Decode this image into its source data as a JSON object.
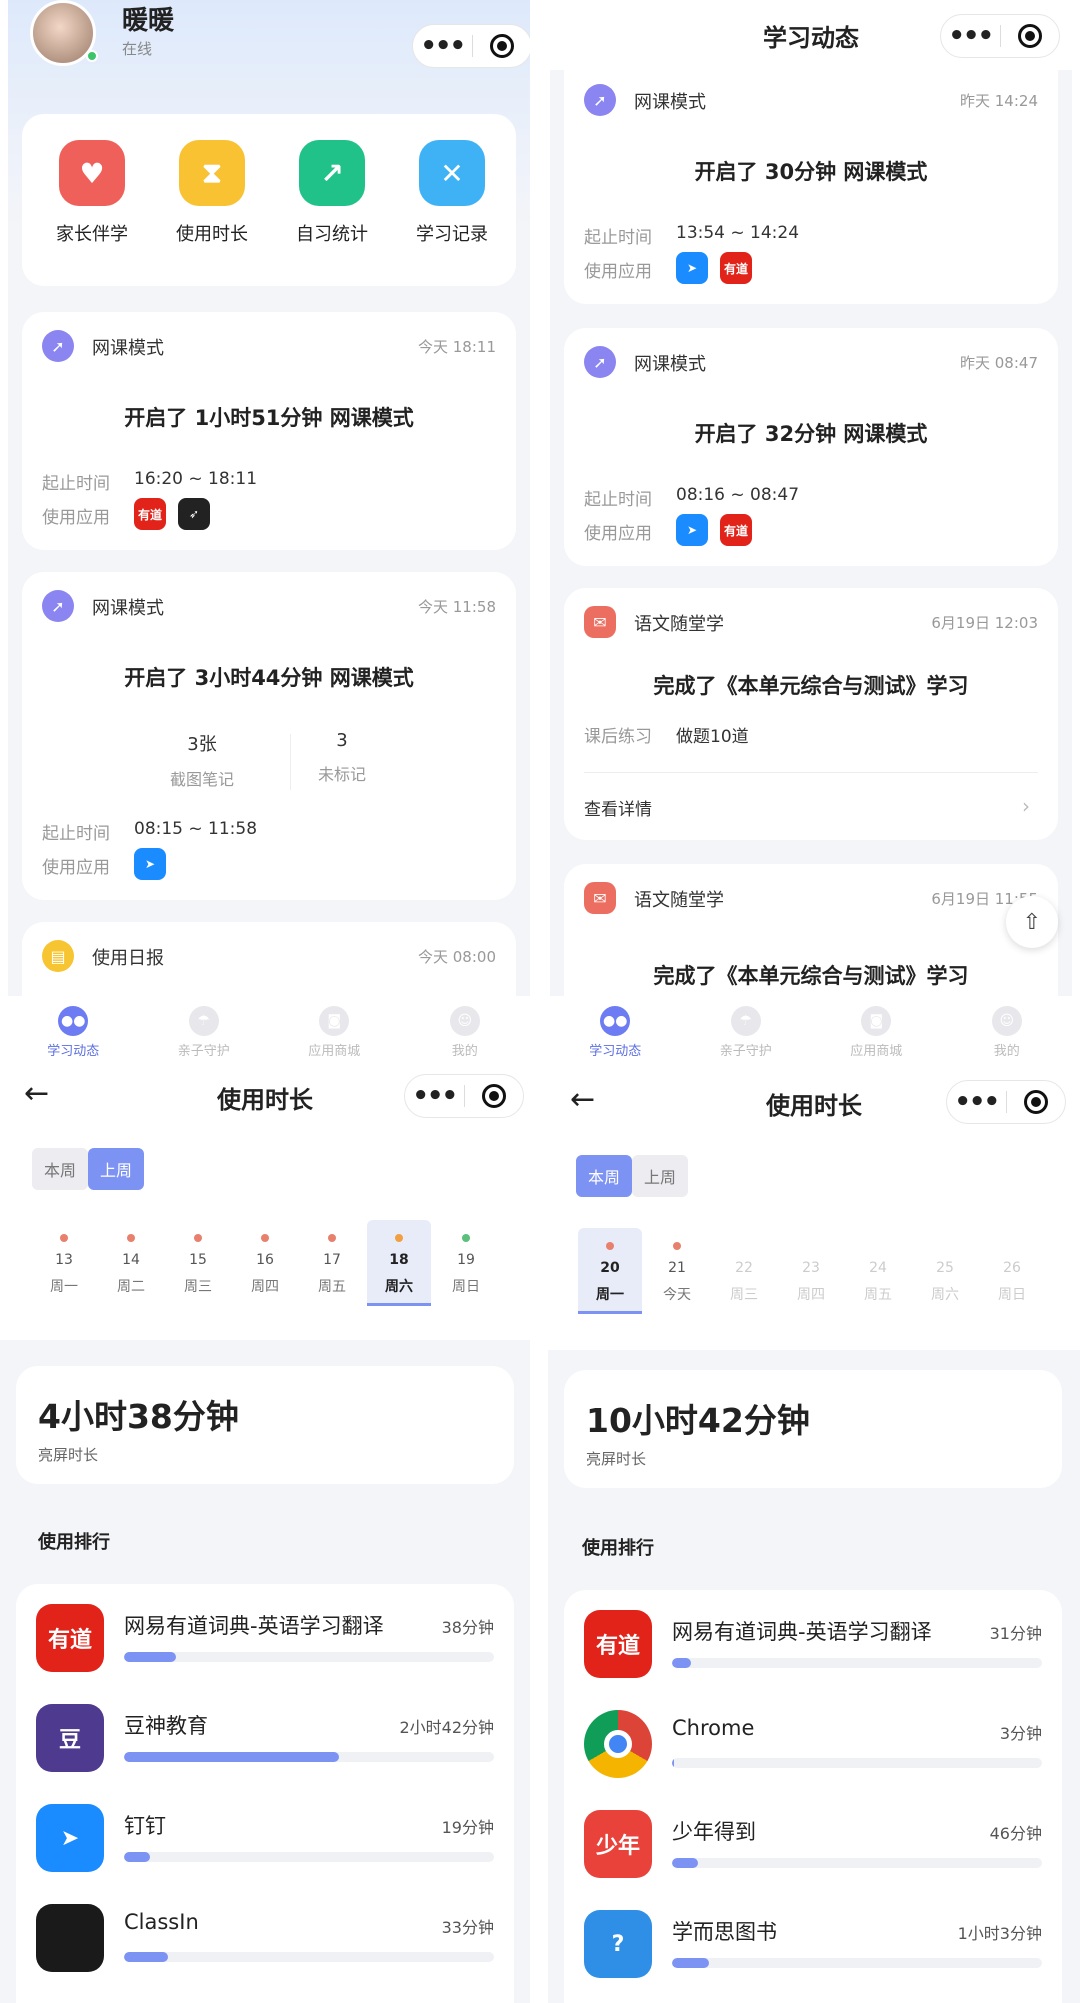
{
  "tl": {
    "user_name": "暖暖",
    "user_status": "在线",
    "menu_dots": "•••",
    "features": [
      {
        "label": "家长伴学",
        "color": "#f0605a",
        "glyph": "♥"
      },
      {
        "label": "使用时长",
        "color": "#f8c232",
        "glyph": "⧗"
      },
      {
        "label": "自习统计",
        "color": "#21c28a",
        "glyph": "↗"
      },
      {
        "label": "学习记录",
        "color": "#3fb2f5",
        "glyph": "✕"
      }
    ],
    "cards": [
      {
        "title": "网课模式",
        "time": "今天 18:11",
        "msg": "开启了 1小时51分钟 网课模式",
        "range_label": "起止时间",
        "range": "16:20 ~ 18:11",
        "apps_label": "使用应用"
      },
      {
        "title": "网课模式",
        "time": "今天 11:58",
        "msg": "开启了 3小时44分钟 网课模式",
        "stat1_val": "3张",
        "stat1_lbl": "截图笔记",
        "stat2_val": "3",
        "stat2_lbl": "未标记",
        "range_label": "起止时间",
        "range": "08:15 ~ 11:58",
        "apps_label": "使用应用"
      },
      {
        "title": "使用日报",
        "time": "今天 08:00"
      }
    ],
    "app_youdao": "有道",
    "tabs": [
      "学习动态",
      "亲子守护",
      "应用商城",
      "我的"
    ]
  },
  "tr": {
    "page_title": "学习动态",
    "menu_dots": "•••",
    "cards": [
      {
        "title": "网课模式",
        "time": "昨天 14:24",
        "msg": "开启了 30分钟 网课模式",
        "range_label": "起止时间",
        "range": "13:54 ~ 14:24",
        "apps_label": "使用应用"
      },
      {
        "title": "网课模式",
        "time": "昨天 08:47",
        "msg": "开启了 32分钟 网课模式",
        "range_label": "起止时间",
        "range": "08:16 ~ 08:47",
        "apps_label": "使用应用"
      },
      {
        "title": "语文随堂学",
        "time": "6月19日 12:03",
        "msg": "完成了《本单元综合与测试》学习",
        "ex_label": "课后练习",
        "ex_val": "做题10道",
        "detail": "查看详情"
      },
      {
        "title": "语文随堂学",
        "time": "6月19日 11:55",
        "msg": "完成了《本单元综合与测试》学习"
      }
    ],
    "app_youdao": "有道",
    "tabs": [
      "学习动态",
      "亲子守护",
      "应用商城",
      "我的"
    ]
  },
  "bl": {
    "page_title": "使用时长",
    "menu_dots": "•••",
    "week_btns": [
      "本周",
      "上周"
    ],
    "days": [
      {
        "num": "13",
        "wd": "周一",
        "dot": "#e8806e"
      },
      {
        "num": "14",
        "wd": "周二",
        "dot": "#e8806e"
      },
      {
        "num": "15",
        "wd": "周三",
        "dot": "#e8806e"
      },
      {
        "num": "16",
        "wd": "周四",
        "dot": "#e8806e"
      },
      {
        "num": "17",
        "wd": "周五",
        "dot": "#e8806e"
      },
      {
        "num": "18",
        "wd": "周六",
        "dot": "#f0a040"
      },
      {
        "num": "19",
        "wd": "周日",
        "dot": "#5cbf7a"
      }
    ],
    "total": "4小时38分钟",
    "total_label": "亮屏时长",
    "rank_title": "使用排行",
    "rank": [
      {
        "name": "网易有道词典-英语学习翻译",
        "time": "38分钟",
        "pct": 14,
        "icon": "有道",
        "color": "#e2231a"
      },
      {
        "name": "豆神教育",
        "time": "2小时42分钟",
        "pct": 58,
        "icon": "豆",
        "color": "#4e3a8e"
      },
      {
        "name": "钉钉",
        "time": "19分钟",
        "pct": 7,
        "icon": "➤",
        "color": "#1a8cff"
      },
      {
        "name": "ClassIn",
        "time": "33分钟",
        "pct": 12,
        "icon": "",
        "color": "#1a1a1a"
      }
    ]
  },
  "br": {
    "page_title": "使用时长",
    "menu_dots": "•••",
    "week_btns": [
      "本周",
      "上周"
    ],
    "days": [
      {
        "num": "20",
        "wd": "周一",
        "dot": "#e8806e"
      },
      {
        "num": "21",
        "wd": "今天",
        "dot": "#e8806e"
      },
      {
        "num": "22",
        "wd": "周三",
        "dot": ""
      },
      {
        "num": "23",
        "wd": "周四",
        "dot": ""
      },
      {
        "num": "24",
        "wd": "周五",
        "dot": ""
      },
      {
        "num": "25",
        "wd": "周六",
        "dot": ""
      },
      {
        "num": "26",
        "wd": "周日",
        "dot": ""
      }
    ],
    "total": "10小时42分钟",
    "total_label": "亮屏时长",
    "rank_title": "使用排行",
    "rank": [
      {
        "name": "网易有道词典-英语学习翻译",
        "time": "31分钟",
        "pct": 5,
        "icon": "有道",
        "color": "#e2231a"
      },
      {
        "name": "Chrome",
        "time": "3分钟",
        "pct": 0.5,
        "icon": "",
        "color": "#ffffff"
      },
      {
        "name": "少年得到",
        "time": "46分钟",
        "pct": 7,
        "icon": "少年",
        "color": "#e8423a"
      },
      {
        "name": "学而思图书",
        "time": "1小时3分钟",
        "pct": 10,
        "icon": "?",
        "color": "#2f8fe6"
      }
    ]
  }
}
